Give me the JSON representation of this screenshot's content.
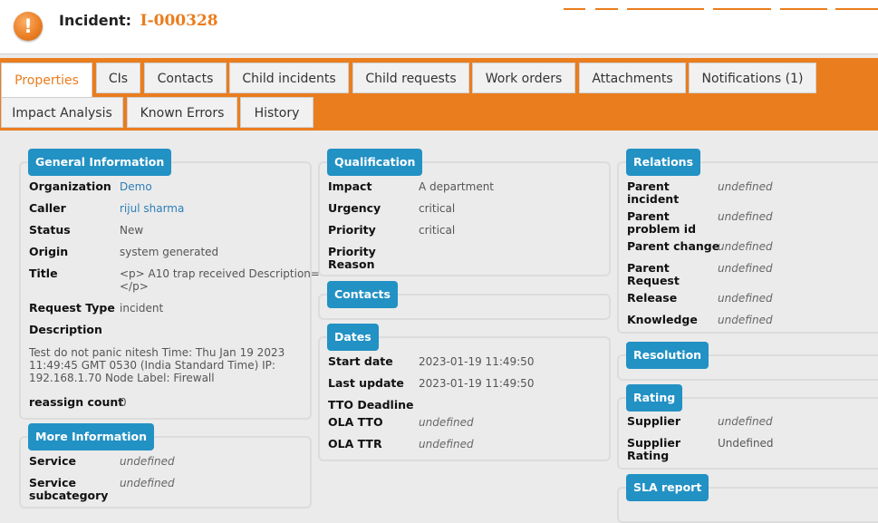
{
  "header": {
    "title_prefix": "Incident:",
    "ref": "I-000328",
    "alert_icon_glyph": "!"
  },
  "colors": {
    "brand": "#ea7d1e",
    "chip": "#2291c4",
    "link": "#2d7eb8",
    "background": "#ebebeb"
  },
  "tabs": [
    "Properties",
    "CIs",
    "Contacts",
    "Child incidents",
    "Child requests",
    "Work orders",
    "Attachments",
    "Notifications (1)",
    "Impact Analysis",
    "Known Errors",
    "History"
  ],
  "general": {
    "heading": "General Information",
    "organization_label": "Organization",
    "organization_value": "Demo",
    "caller_label": "Caller",
    "caller_value": "rijul sharma",
    "status_label": "Status",
    "status_value": "New",
    "origin_label": "Origin",
    "origin_value": "system generated",
    "title_label": "Title",
    "title_value_1": "<p> A10 trap received Description=",
    "title_value_2": "</p>",
    "request_type_label": "Request Type",
    "request_type_value": "incident",
    "description_label": "Description",
    "description_line_1": "Test do not panic nitesh Time: Thu Jan 19 2023",
    "description_line_2": "11:49:45 GMT 0530 (India Standard Time) IP:",
    "description_line_3": "192.168.1.70 Node Label: Firewall",
    "reassign_label": "reassign count",
    "reassign_value": "0"
  },
  "more": {
    "heading": "More Information",
    "service_label": "Service",
    "service_value": "undefined",
    "subcat_label_1": "Service",
    "subcat_label_2": "subcategory",
    "subcat_value": "undefined"
  },
  "qualification": {
    "heading": "Qualification",
    "impact_label": "Impact",
    "impact_value": "A department",
    "urgency_label": "Urgency",
    "urgency_value": "critical",
    "priority_label": "Priority",
    "priority_value": "critical",
    "reason_label_1": "Priority",
    "reason_label_2": "Reason"
  },
  "contacts": {
    "heading": "Contacts"
  },
  "dates": {
    "heading": "Dates",
    "start_label": "Start date",
    "start_value": "2023-01-19 11:49:50",
    "update_label": "Last update",
    "update_value": "2023-01-19 11:49:50",
    "tto_label": "TTO Deadline",
    "ola_tto_label": "OLA TTO",
    "ola_tto_value": "undefined",
    "ola_ttr_label": "OLA TTR",
    "ola_ttr_value": "undefined"
  },
  "relations": {
    "heading": "Relations",
    "parent_incident_label_1": "Parent",
    "parent_incident_label_2": "incident",
    "parent_incident_value": "undefined",
    "parent_problem_label_1": "Parent",
    "parent_problem_label_2": "problem id",
    "parent_problem_value": "undefined",
    "parent_change_label": "Parent change",
    "parent_change_value": "undefined",
    "parent_request_label_1": "Parent",
    "parent_request_label_2": "Request",
    "parent_request_value": "undefined",
    "release_label": "Release",
    "release_value": "undefined",
    "knowledge_label": "Knowledge",
    "knowledge_value": "undefined"
  },
  "resolution": {
    "heading": "Resolution"
  },
  "rating": {
    "heading": "Rating",
    "supplier_label": "Supplier",
    "supplier_value": "undefined",
    "supplier_rating_label_1": "Supplier",
    "supplier_rating_label_2": "Rating",
    "supplier_rating_value": "Undefined"
  },
  "sla": {
    "heading": "SLA report"
  }
}
